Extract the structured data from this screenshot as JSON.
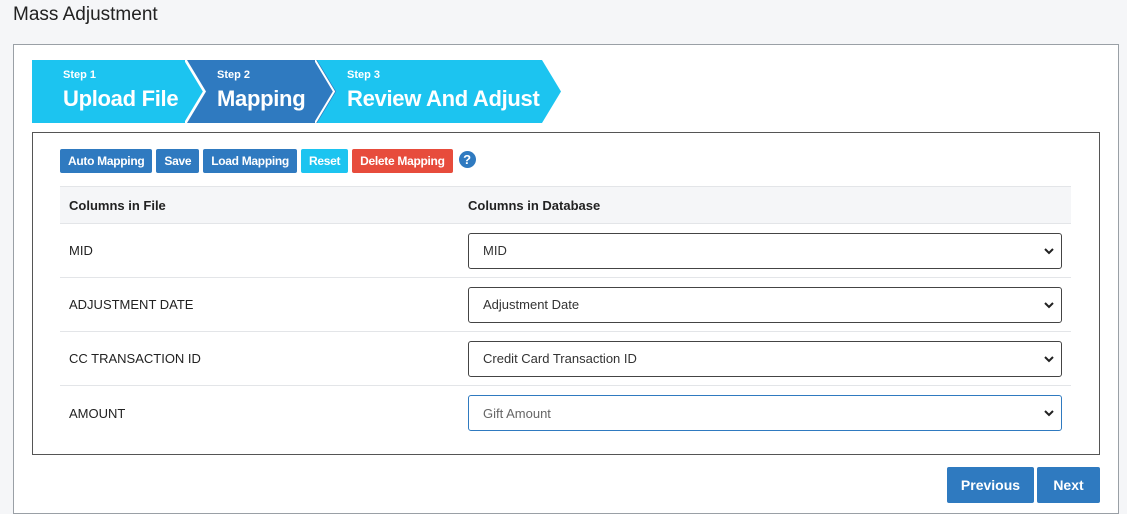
{
  "page": {
    "title": "Mass Adjustment"
  },
  "wizard": {
    "steps": [
      {
        "number": "Step 1",
        "label": "Upload File",
        "color": "#1cc4f0"
      },
      {
        "number": "Step 2",
        "label": "Mapping",
        "color": "#2f7ac0"
      },
      {
        "number": "Step 3",
        "label": "Review And Adjust",
        "color": "#1cc4f0"
      }
    ],
    "active_step": "Step 2"
  },
  "toolbar": {
    "auto_mapping": "Auto Mapping",
    "save": "Save",
    "load_mapping": "Load Mapping",
    "reset": "Reset",
    "delete_mapping": "Delete Mapping",
    "help": "?"
  },
  "table": {
    "headers": [
      "Columns in File",
      "Columns in Database"
    ],
    "rows": [
      {
        "file_column": "MID",
        "db_column": "MID"
      },
      {
        "file_column": "ADJUSTMENT DATE",
        "db_column": "Adjustment Date"
      },
      {
        "file_column": "CC TRANSACTION ID",
        "db_column": "Credit Card Transaction ID"
      },
      {
        "file_column": "AMOUNT",
        "db_column": "Gift Amount"
      }
    ]
  },
  "nav": {
    "previous": "Previous",
    "next": "Next"
  },
  "colors": {
    "primary": "#2f7ac0",
    "info": "#1cc4f0",
    "danger": "#e74c3c"
  }
}
